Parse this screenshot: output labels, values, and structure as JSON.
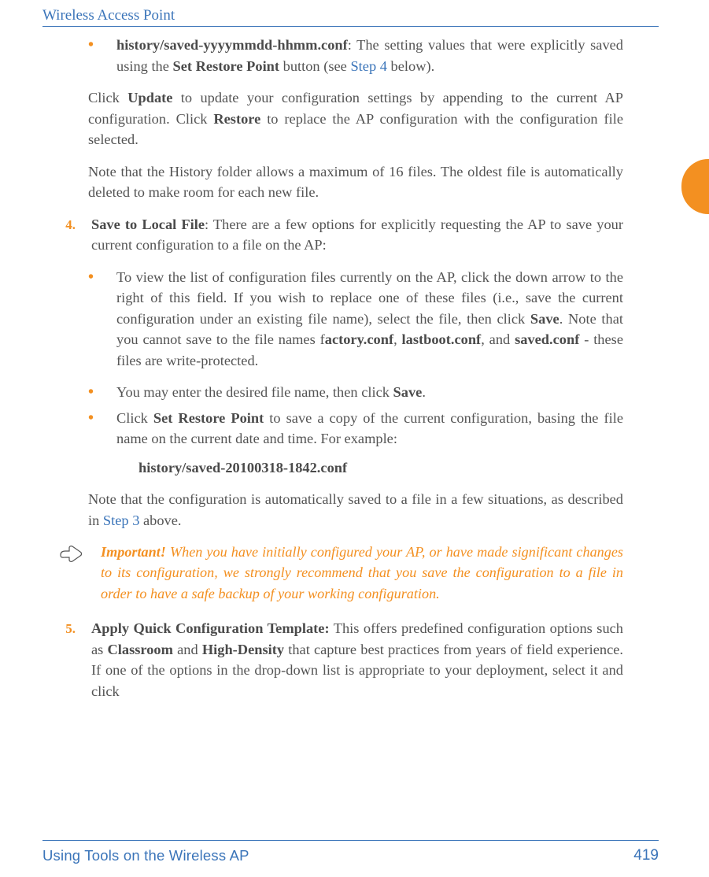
{
  "header": {
    "running_head": "Wireless Access Point"
  },
  "body": {
    "bullet1_prefix": "history/saved-yyyymmdd-hhmm.conf",
    "bullet1_text": ": The setting values that were explicitly saved using the ",
    "bullet1_bold1": "Set Restore Point",
    "bullet1_text2": " button (see ",
    "bullet1_link": "Step 4",
    "bullet1_text3": " below).",
    "para1a": "Click ",
    "para1b": "Update",
    "para1c": " to update your configuration settings by appending to the current AP configuration. Click ",
    "para1d": "Restore",
    "para1e": " to replace the AP configuration with the configuration file selected.",
    "para2": "Note that the History folder allows a maximum of 16 files. The oldest file is automatically deleted to make room for each new file.",
    "step4_num": "4.",
    "step4_bold": "Save to Local File",
    "step4_text": ": There are a few options for explicitly requesting the AP to save your current configuration to a file on the AP:",
    "s4b1a": "To view the list of configuration files currently on the AP, click the down arrow to the right of this field. If you wish to replace one of these files (i.e., save the current configuration under an existing file name), select the file, then click ",
    "s4b1b": "Save",
    "s4b1c": ". Note that you cannot save to the file names f",
    "s4b1d": "actory.conf",
    "s4b1e": ", ",
    "s4b1f": "lastboot.conf",
    "s4b1g": ", and ",
    "s4b1h": "saved.conf",
    "s4b1i": " - these files are write-protected.",
    "s4b2a": "You may enter the desired file name, then click ",
    "s4b2b": "Save",
    "s4b2c": ".",
    "s4b3a": "Click ",
    "s4b3b": "Set Restore Point",
    "s4b3c": " to save a copy of the current configuration, basing the file name on the current date and time. For example:",
    "example_path": "history/saved-20100318-1842.conf",
    "s4_note_a": "Note that the configuration is automatically saved to a file in a few situations, as described in ",
    "s4_note_link": "Step 3",
    "s4_note_b": " above.",
    "important_head": "Important!",
    "important_text": " When you have initially configured your AP, or have made significant changes to its configuration, we strongly recommend that you save the configuration to a file in order to have a safe backup of your working configuration.",
    "step5_num": "5.",
    "step5_bold": "Apply Quick Configuration Template:",
    "step5a": " This offers predefined configuration options such as ",
    "step5b": "Classroom",
    "step5c": " and ",
    "step5d": "High-Density",
    "step5e": " that capture best practices from years of field experience. If one of the options in the drop-down list is appropriate to your deployment, select it and click"
  },
  "footer": {
    "left": "Using Tools on the Wireless AP",
    "right": "419"
  }
}
